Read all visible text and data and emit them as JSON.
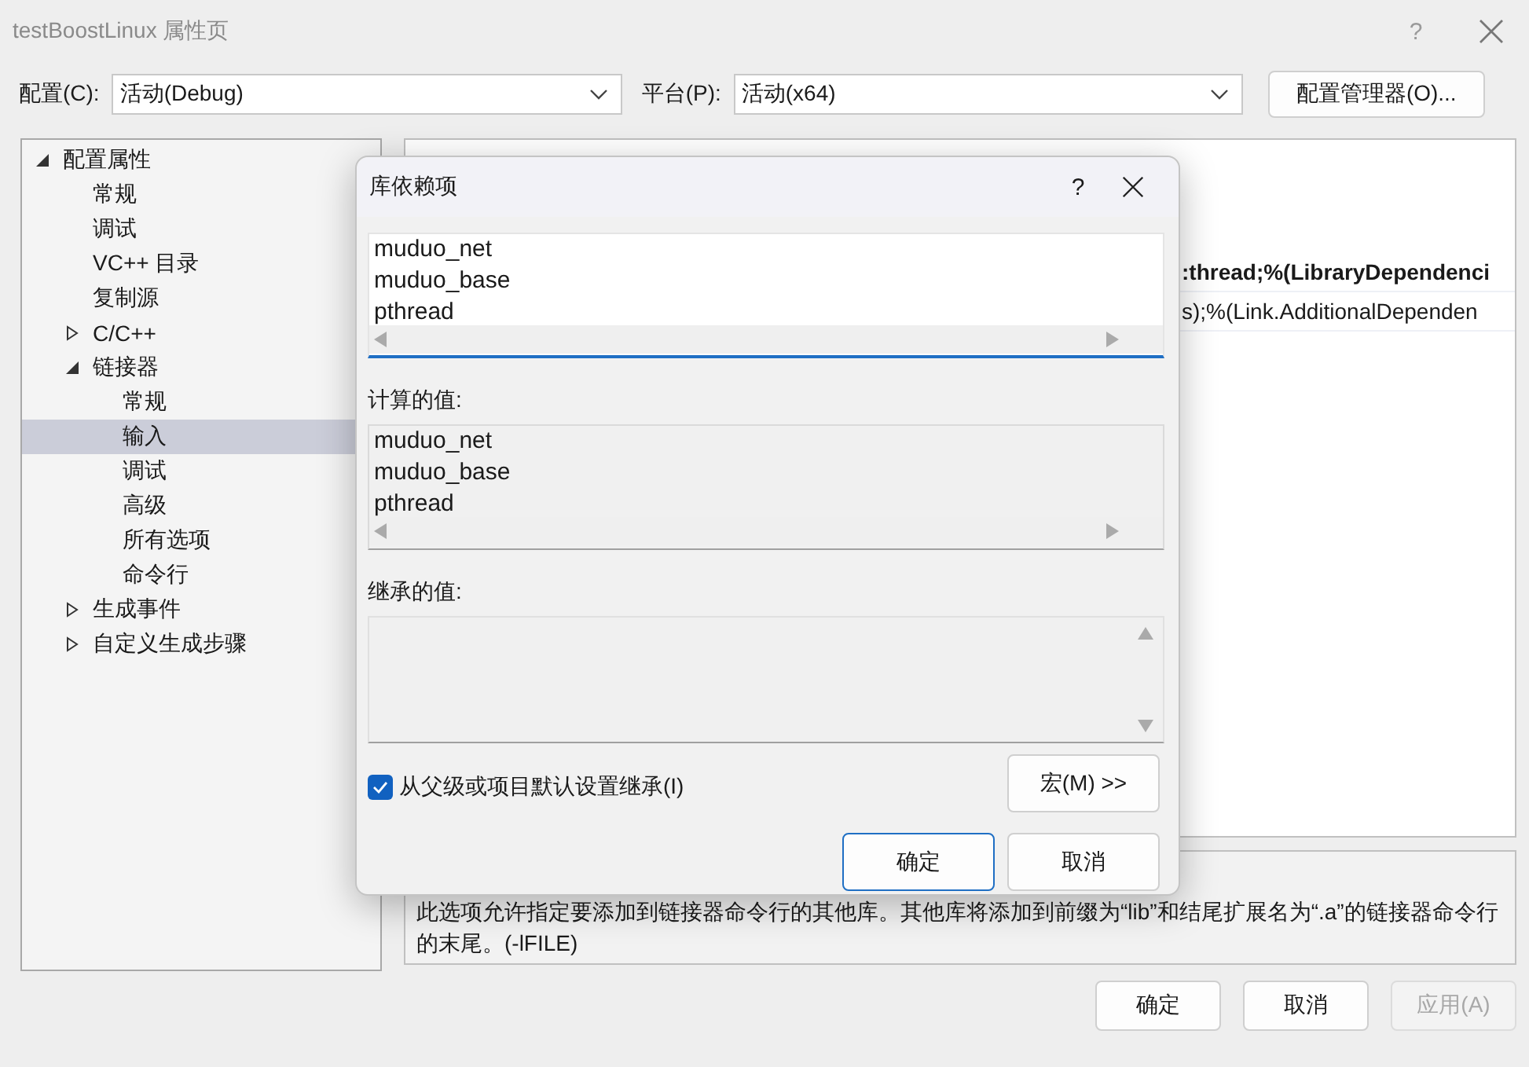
{
  "window": {
    "title": "testBoostLinux 属性页",
    "help": "?"
  },
  "toolbar": {
    "configuration": {
      "label": "配置(C):",
      "value": "活动(Debug)"
    },
    "platform": {
      "label": "平台(P):",
      "value": "活动(x64)"
    },
    "manager_button": "配置管理器(O)..."
  },
  "tree": [
    {
      "label": "配置属性",
      "expanded": true,
      "selected": false,
      "children": [
        {
          "label": "常规",
          "selected": false
        },
        {
          "label": "调试",
          "selected": false
        },
        {
          "label": "VC++ 目录",
          "selected": false
        },
        {
          "label": "复制源",
          "selected": false
        },
        {
          "label": "C/C++",
          "expanded": false,
          "selected": false
        },
        {
          "label": "链接器",
          "expanded": true,
          "selected": false,
          "children": [
            {
              "label": "常规",
              "selected": false
            },
            {
              "label": "输入",
              "selected": true
            },
            {
              "label": "调试",
              "selected": false
            },
            {
              "label": "高级",
              "selected": false
            },
            {
              "label": "所有选项",
              "selected": false
            },
            {
              "label": "命令行",
              "selected": false
            }
          ]
        },
        {
          "label": "生成事件",
          "expanded": false,
          "selected": false
        },
        {
          "label": "自定义生成步骤",
          "expanded": false,
          "selected": false
        }
      ]
    }
  ],
  "property_grid": {
    "rows": [
      {
        "value": ":thread;%(LibraryDependenci",
        "bold": true
      },
      {
        "value": "s);%(Link.AdditionalDependen",
        "bold": false
      }
    ]
  },
  "description": "此选项允许指定要添加到链接器命令行的其他库。其他库将添加到前缀为“lib”和结尾扩展名为“.a”的链接器命令行的末尾。(-lFILE)",
  "buttons": [
    {
      "label": "确定",
      "disabled": false
    },
    {
      "label": "取消",
      "disabled": false
    },
    {
      "label": "应用(A)",
      "disabled": true
    }
  ],
  "dialog": {
    "title": "库依赖项",
    "help": "?",
    "edit_lines": [
      "muduo_net",
      "muduo_base",
      "pthread"
    ],
    "computed_label": "计算的值:",
    "computed_lines": [
      "muduo_net",
      "muduo_base",
      "pthread"
    ],
    "inherited_label": "继承的值:",
    "inherit_checkbox": {
      "label": "从父级或项目默认设置继承(I)",
      "checked": true
    },
    "macros_button": "宏(M) >>",
    "buttons": [
      {
        "label": "确定",
        "default": true
      },
      {
        "label": "取消",
        "default": false
      }
    ]
  }
}
